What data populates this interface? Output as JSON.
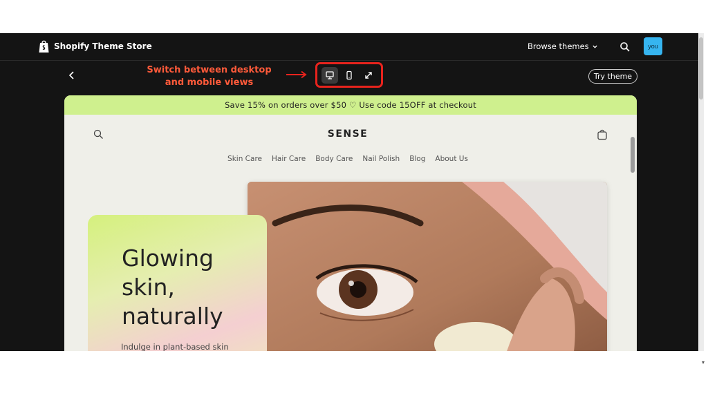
{
  "topbar": {
    "app_title": "Shopify Theme Store",
    "browse_label": "Browse themes",
    "avatar_text": "you"
  },
  "toolbar": {
    "annotation": "Switch between desktop and mobile views",
    "try_theme_label": "Try theme"
  },
  "store": {
    "announcement": "Save 15% on orders over $50 ♡ Use code 15OFF at checkout",
    "brand": "SENSE",
    "nav": [
      "Skin Care",
      "Hair Care",
      "Body Care",
      "Nail Polish",
      "Blog",
      "About Us"
    ],
    "hero_title": "Glowing skin, naturally",
    "hero_subtitle": "Indulge in plant-based skin"
  },
  "colors": {
    "annotation": "#ff5a3a",
    "highlight_box": "#e8231d",
    "announcement_bg": "#cff08e",
    "avatar_bg": "#36b5f0"
  }
}
